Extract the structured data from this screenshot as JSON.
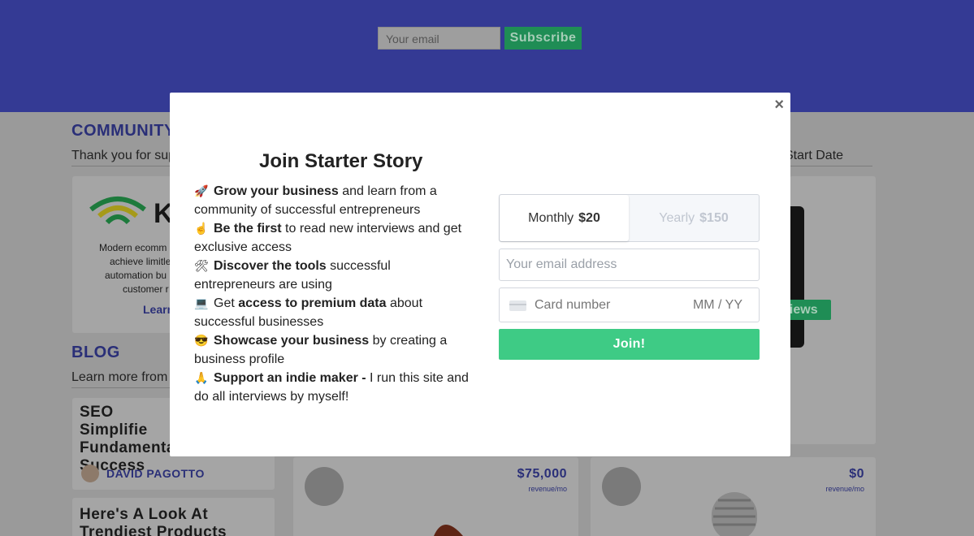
{
  "hero": {
    "email_placeholder": "Your email",
    "subscribe_label": "Subscribe"
  },
  "community": {
    "title": "COMMUNITY",
    "subtitle_partial": "Thank you for sup",
    "start_date_label": "Start Date",
    "card": {
      "logo_letter": "K",
      "description_lines": [
        "Modern ecomm",
        "achieve limitle",
        "automation bu",
        "customer r"
      ],
      "learn_label": "Learn"
    }
  },
  "blog": {
    "title": "BLOG",
    "subtitle_partial": "Learn more from t",
    "posts": [
      {
        "title": "SEO Simplifie Fundamental Success",
        "author": "DAVID PAGOTTO"
      },
      {
        "title": "Here's A Look At Trendiest Products Selling In Winter"
      }
    ]
  },
  "interviews": {
    "badge_partial": "views",
    "revenue_unit": "revenue/mo",
    "items": [
      {
        "revenue": "$75,000"
      },
      {
        "revenue": "$0"
      }
    ]
  },
  "modal": {
    "close_symbol": "×",
    "title": "Join Starter Story",
    "benefits": [
      {
        "icon": "🚀",
        "bold_prefix": "",
        "bold": "Grow your business",
        "rest": " and learn from a community of successful entrepreneurs"
      },
      {
        "icon": "☝️",
        "bold_prefix": "",
        "bold": "Be the first",
        "rest": " to read new interviews and get exclusive access"
      },
      {
        "icon": "🛠",
        "bold_prefix": "",
        "bold": "Discover the tools",
        "rest": " successful entrepreneurs are using"
      },
      {
        "icon": "💻",
        "bold_prefix": "Get ",
        "bold": "access to premium data",
        "rest": " about successful businesses"
      },
      {
        "icon": "😎",
        "bold_prefix": "",
        "bold": "Showcase your business",
        "rest": " by creating a business profile"
      },
      {
        "icon": "🙏",
        "bold_prefix": "",
        "bold": "Support an indie maker -",
        "rest": " I run this site and do all interviews by myself!"
      }
    ],
    "plans": {
      "monthly_label": "Monthly",
      "monthly_price": "$20",
      "yearly_label": "Yearly",
      "yearly_price": "$150",
      "selected": "Monthly"
    },
    "email_placeholder": "Your email address",
    "card_placeholder": "Card number",
    "expiry_placeholder": "MM / YY",
    "join_label": "Join!"
  },
  "colors": {
    "hero_bg": "#343a94",
    "join_green": "#3ecb85",
    "title_blue": "#2a2f78"
  }
}
